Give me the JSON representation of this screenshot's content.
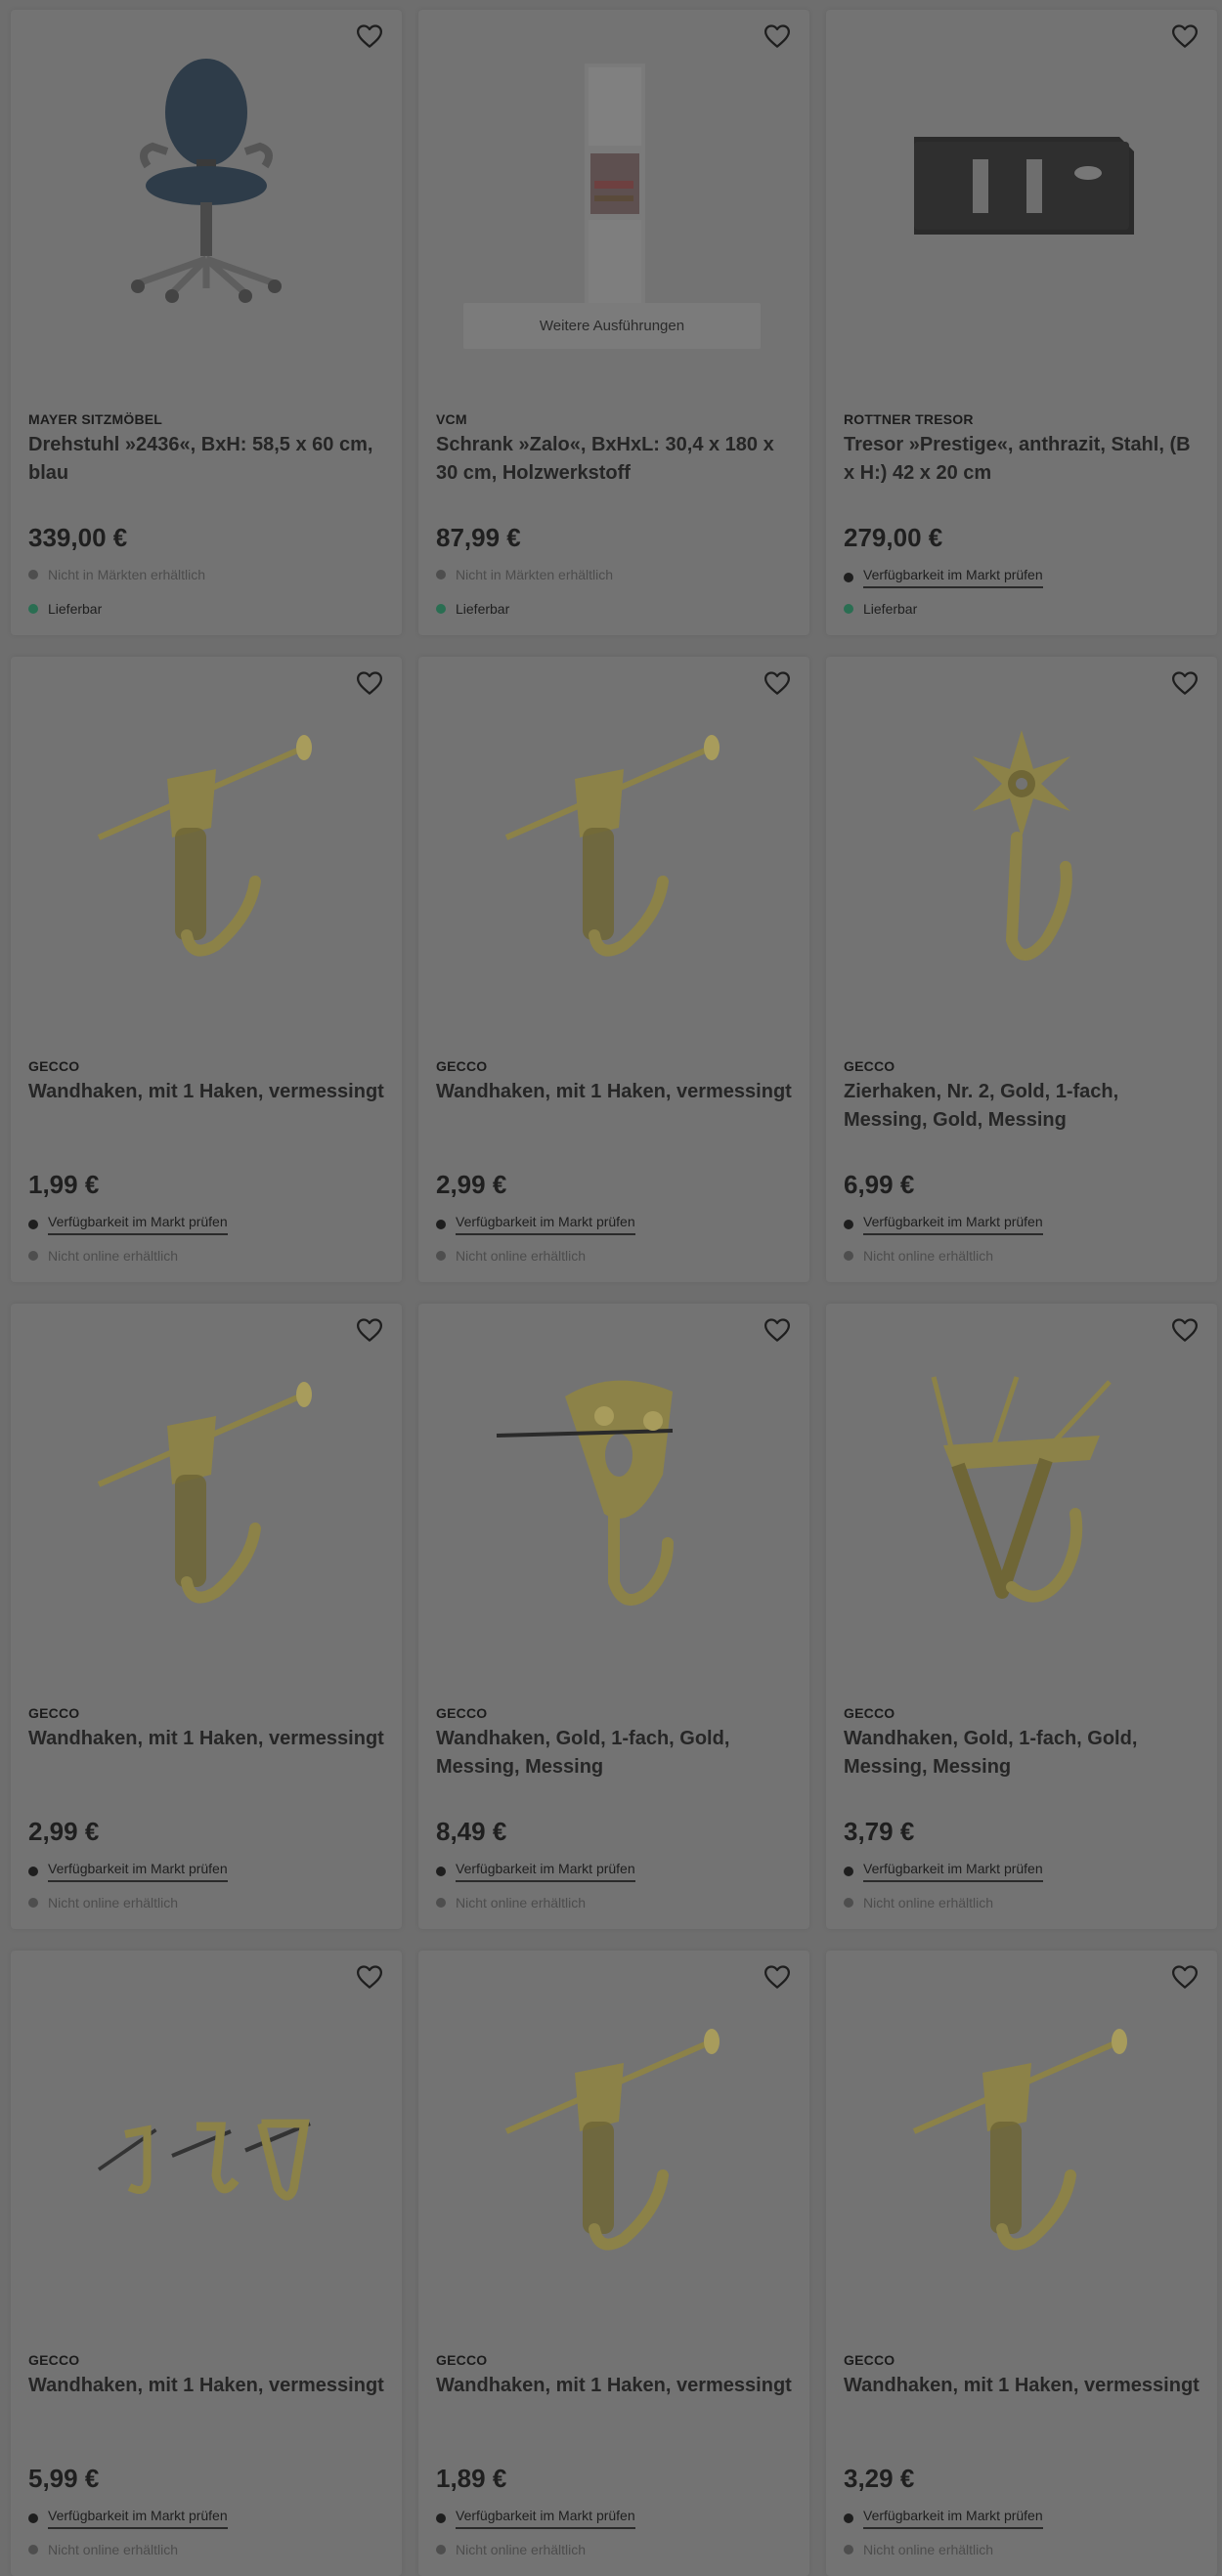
{
  "products": [
    {
      "brand": "MAYER SITZMÖBEL",
      "name": "Drehstuhl »2436«, BxH: 58,5 x 60 cm, blau",
      "price": "339,00 €",
      "image_icon": "office-chair-image",
      "variants_label": "",
      "status1": {
        "text": "Nicht in Märkten erhältlich",
        "style": "muted",
        "dot": "grey"
      },
      "status2": {
        "text": "Lieferbar",
        "style": "dark",
        "dot": "green"
      }
    },
    {
      "brand": "VCM",
      "name": "Schrank »Zalo«, BxHxL: 30,4 x 180 x 30 cm, Holzwerkstoff",
      "price": "87,99 €",
      "image_icon": "cabinet-image",
      "variants_label": "Weitere Ausführungen",
      "status1": {
        "text": "Nicht in Märkten erhältlich",
        "style": "muted",
        "dot": "grey"
      },
      "status2": {
        "text": "Lieferbar",
        "style": "dark",
        "dot": "green"
      }
    },
    {
      "brand": "ROTTNER TRESOR",
      "name": "Tresor »Prestige«, anthrazit, Stahl, (B x H:) 42 x 20 cm",
      "price": "279,00 €",
      "image_icon": "safe-image",
      "variants_label": "",
      "status1": {
        "text": "Verfügbarkeit im Markt prüfen",
        "style": "link",
        "dot": "dark"
      },
      "status2": {
        "text": "Lieferbar",
        "style": "dark",
        "dot": "green"
      }
    },
    {
      "brand": "GECCO",
      "name": "Wandhaken, mit 1 Haken, vermessingt",
      "price": "1,99 €",
      "image_icon": "wall-hook-image",
      "variants_label": "",
      "status1": {
        "text": "Verfügbarkeit im Markt prüfen",
        "style": "link",
        "dot": "dark"
      },
      "status2": {
        "text": "Nicht online erhältlich",
        "style": "muted",
        "dot": "grey"
      }
    },
    {
      "brand": "GECCO",
      "name": "Wandhaken, mit 1 Haken, vermessingt",
      "price": "2,99 €",
      "image_icon": "wall-hook-image",
      "variants_label": "",
      "status1": {
        "text": "Verfügbarkeit im Markt prüfen",
        "style": "link",
        "dot": "dark"
      },
      "status2": {
        "text": "Nicht online erhältlich",
        "style": "muted",
        "dot": "grey"
      }
    },
    {
      "brand": "GECCO",
      "name": "Zierhaken, Nr. 2, Gold, 1-fach, Messing, Gold, Messing",
      "price": "6,99 €",
      "image_icon": "decorative-hook-image",
      "variants_label": "",
      "status1": {
        "text": "Verfügbarkeit im Markt prüfen",
        "style": "link",
        "dot": "dark"
      },
      "status2": {
        "text": "Nicht online erhältlich",
        "style": "muted",
        "dot": "grey"
      }
    },
    {
      "brand": "GECCO",
      "name": "Wandhaken, mit 1 Haken, vermessingt",
      "price": "2,99 €",
      "image_icon": "wall-hook-image",
      "variants_label": "",
      "status1": {
        "text": "Verfügbarkeit im Markt prüfen",
        "style": "link",
        "dot": "dark"
      },
      "status2": {
        "text": "Nicht online erhältlich",
        "style": "muted",
        "dot": "grey"
      }
    },
    {
      "brand": "GECCO",
      "name": "Wandhaken, Gold, 1-fach, Gold, Messing, Messing",
      "price": "8,49 €",
      "image_icon": "plate-hook-image",
      "variants_label": "",
      "status1": {
        "text": "Verfügbarkeit im Markt prüfen",
        "style": "link",
        "dot": "dark"
      },
      "status2": {
        "text": "Nicht online erhältlich",
        "style": "muted",
        "dot": "grey"
      }
    },
    {
      "brand": "GECCO",
      "name": "Wandhaken, Gold, 1-fach, Gold, Messing, Messing",
      "price": "3,79 €",
      "image_icon": "triple-nail-hook-image",
      "variants_label": "",
      "status1": {
        "text": "Verfügbarkeit im Markt prüfen",
        "style": "link",
        "dot": "dark"
      },
      "status2": {
        "text": "Nicht online erhältlich",
        "style": "muted",
        "dot": "grey"
      }
    },
    {
      "brand": "GECCO",
      "name": "Wandhaken, mit 1 Haken, vermessingt",
      "price": "5,99 €",
      "image_icon": "hook-set-image",
      "variants_label": "",
      "status1": {
        "text": "Verfügbarkeit im Markt prüfen",
        "style": "link",
        "dot": "dark"
      },
      "status2": {
        "text": "Nicht online erhältlich",
        "style": "muted",
        "dot": "grey"
      }
    },
    {
      "brand": "GECCO",
      "name": "Wandhaken, mit 1 Haken, vermessingt",
      "price": "1,89 €",
      "image_icon": "wall-hook-image",
      "variants_label": "",
      "status1": {
        "text": "Verfügbarkeit im Markt prüfen",
        "style": "link",
        "dot": "dark"
      },
      "status2": {
        "text": "Nicht online erhältlich",
        "style": "muted",
        "dot": "grey"
      }
    },
    {
      "brand": "GECCO",
      "name": "Wandhaken, mit 1 Haken, vermessingt",
      "price": "3,29 €",
      "image_icon": "wall-hook-image",
      "variants_label": "",
      "status1": {
        "text": "Verfügbarkeit im Markt prüfen",
        "style": "link",
        "dot": "dark"
      },
      "status2": {
        "text": "Nicht online erhältlich",
        "style": "muted",
        "dot": "grey"
      }
    }
  ],
  "colors": {
    "overlay_bg": "#6e6e6e",
    "card_bg": "#737373",
    "brass": "#8a7f45",
    "available_dot": "#2a6e52"
  }
}
